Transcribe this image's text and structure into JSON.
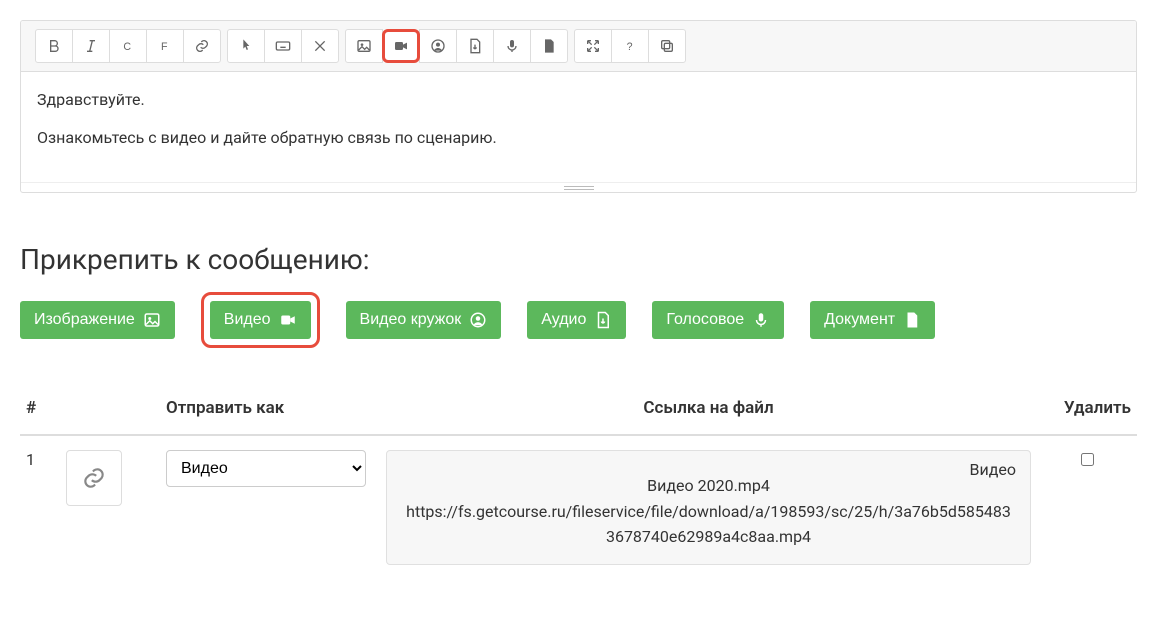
{
  "editor": {
    "toolbar": [
      {
        "name": "bold-btn",
        "group": 0,
        "icon": "bold"
      },
      {
        "name": "italic-btn",
        "group": 0,
        "icon": "italic"
      },
      {
        "name": "c-btn",
        "group": 0,
        "icon": "letter-c"
      },
      {
        "name": "f-btn",
        "group": 0,
        "icon": "letter-f"
      },
      {
        "name": "link-btn",
        "group": 0,
        "icon": "link"
      },
      {
        "name": "pointer-btn",
        "group": 1,
        "icon": "pointer"
      },
      {
        "name": "keyboard-btn",
        "group": 1,
        "icon": "keyboard"
      },
      {
        "name": "remove-btn",
        "group": 1,
        "icon": "times"
      },
      {
        "name": "image-btn",
        "group": 2,
        "icon": "image"
      },
      {
        "name": "video-btn",
        "group": 2,
        "icon": "video",
        "highlight": true
      },
      {
        "name": "user-btn",
        "group": 2,
        "icon": "user"
      },
      {
        "name": "audiofile-btn",
        "group": 2,
        "icon": "file-audio"
      },
      {
        "name": "mic-btn",
        "group": 2,
        "icon": "mic"
      },
      {
        "name": "doc-btn",
        "group": 2,
        "icon": "file"
      },
      {
        "name": "expand-btn",
        "group": 3,
        "icon": "expand"
      },
      {
        "name": "help-btn",
        "group": 3,
        "icon": "question"
      },
      {
        "name": "copy-btn",
        "group": 3,
        "icon": "copy"
      }
    ],
    "content": {
      "line1": "Здравствуйте.",
      "line2": "Ознакомьтесь с видео и дайте обратную связь по сценарию."
    }
  },
  "attach": {
    "title": "Прикрепить к сообщению:",
    "buttons": {
      "image": {
        "label": "Изображение",
        "icon": "image"
      },
      "video": {
        "label": "Видео",
        "icon": "video",
        "highlight": true
      },
      "circle": {
        "label": "Видео кружок",
        "icon": "user"
      },
      "audio": {
        "label": "Аудио",
        "icon": "file-audio"
      },
      "voice": {
        "label": "Голосовое",
        "icon": "mic"
      },
      "doc": {
        "label": "Документ",
        "icon": "file"
      }
    }
  },
  "table": {
    "headers": {
      "idx": "#",
      "send_as": "Отправить как",
      "link": "Ссылка на файл",
      "del": "Удалить"
    },
    "row": {
      "idx": "1",
      "select_value": "Видео",
      "file_type_label": "Видео",
      "file_name": "Видео 2020.mp4",
      "file_url": "https://fs.getcourse.ru/fileservice/file/download/a/198593/sc/25/h/3a76b5d5854833678740e62989a4c8aa.mp4"
    }
  }
}
